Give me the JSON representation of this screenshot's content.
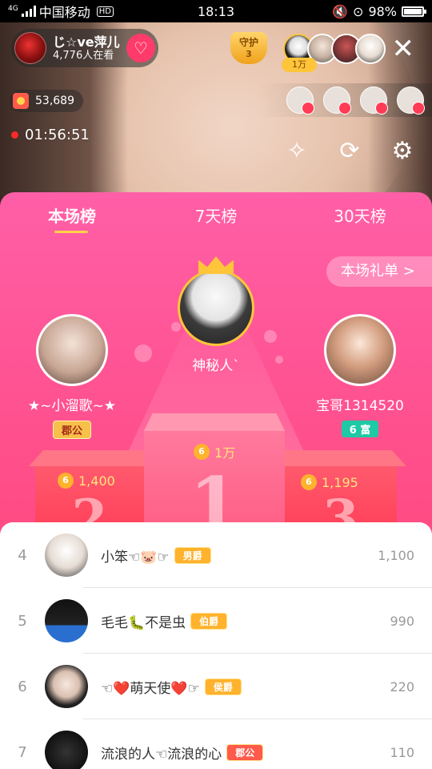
{
  "status_bar": {
    "network": "4G",
    "carrier": "中国移动",
    "hd": "HD",
    "time": "18:13",
    "battery": "98%",
    "battery_level": 0.98
  },
  "host": {
    "name": "じ☆ve萍儿",
    "viewers": "4,776人在看",
    "follow_icon": "heart-plus-icon"
  },
  "guard": {
    "label": "守护",
    "count": "3"
  },
  "top_viewer_tag": "1万",
  "coins": {
    "value": "53,689"
  },
  "live_time": "01:56:51",
  "tabs": [
    {
      "label": "本场榜",
      "active": true
    },
    {
      "label": "7天榜",
      "active": false
    },
    {
      "label": "30天榜",
      "active": false
    }
  ],
  "gift_list_button": "本场礼单 >",
  "podium": {
    "first": {
      "name": "神秘人`",
      "score": "1万",
      "place": "1"
    },
    "second": {
      "name": "★~小溜歌~★",
      "badge": "郡公",
      "score": "1,400",
      "place": "2"
    },
    "third": {
      "name": "宝哥1314520",
      "badge": "6 富",
      "score": "1,195",
      "place": "3"
    }
  },
  "coin_symbol": "6",
  "ranking": [
    {
      "rank": "4",
      "name": "小笨☜🐷☞",
      "badge": "男爵",
      "score": "1,100"
    },
    {
      "rank": "5",
      "name": "毛毛🐛不是虫",
      "badge": "伯爵",
      "score": "990"
    },
    {
      "rank": "6",
      "name": "☜❤️萌天使❤️☞",
      "badge": "侯爵",
      "score": "220"
    },
    {
      "rank": "7",
      "name": "流浪的人☜流浪的心",
      "badge": "郡公",
      "score": "110"
    }
  ],
  "colors": {
    "panel_top": "#ff5fa7",
    "panel_bottom": "#ff3f6e",
    "gold": "#ffc53a",
    "follow": "#ff3b6b"
  }
}
